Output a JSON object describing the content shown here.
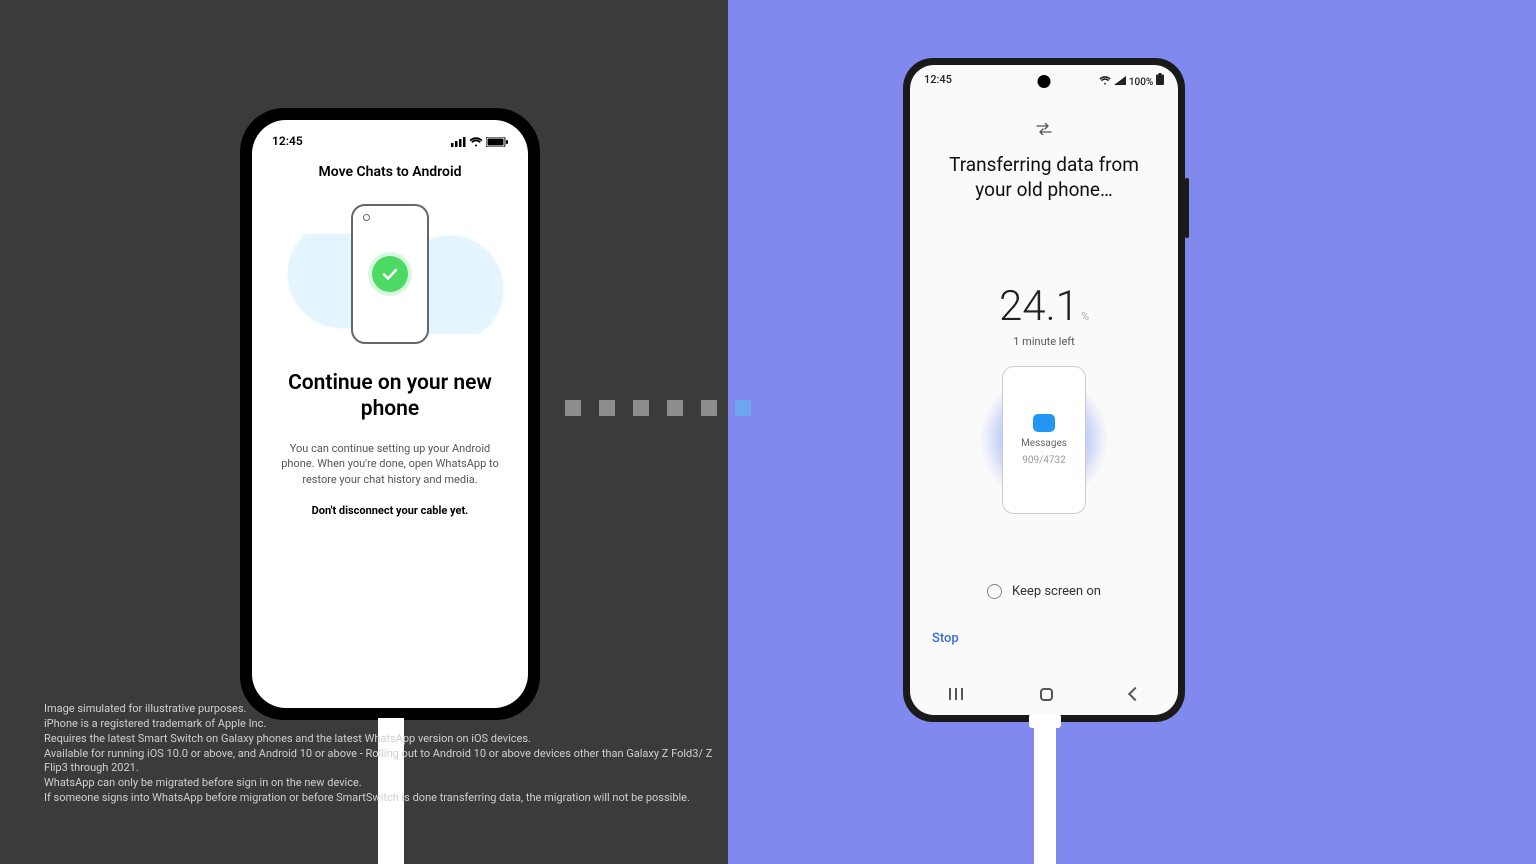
{
  "left_phone": {
    "status_time": "12:45",
    "screen_title": "Move Chats to Android",
    "heading": "Continue on your new phone",
    "body": "You can continue setting up your Android phone. When you're done, open WhatsApp to restore your chat history and media.",
    "warning": "Don't disconnect your cable yet."
  },
  "right_phone": {
    "status_time": "12:45",
    "status_batt": "100%",
    "title": "Transferring data from your old phone…",
    "percent": "24.1",
    "percent_unit": "%",
    "eta": "1 minute left",
    "card_label": "Messages",
    "card_count": "909/4732",
    "keep_screen_label": "Keep screen on",
    "stop_label": "Stop"
  },
  "disclaimer": {
    "l1": "Image simulated for illustrative purposes.",
    "l2": "iPhone is a registered trademark of Apple Inc.",
    "l3": "Requires the latest Smart Switch on Galaxy phones and the latest WhatsApp version on iOS devices.",
    "l4": "Available for running iOS 10.0 or above, and Android 10 or above - Rolling out to Android 10 or above devices other than Galaxy Z Fold3/ Z Flip3 through 2021.",
    "l5": "WhatsApp can only be migrated before sign in on the new device.",
    "l6": "If someone signs into WhatsApp before migration or before SmartSwitch is done transferring data, the migration will not be possible."
  }
}
